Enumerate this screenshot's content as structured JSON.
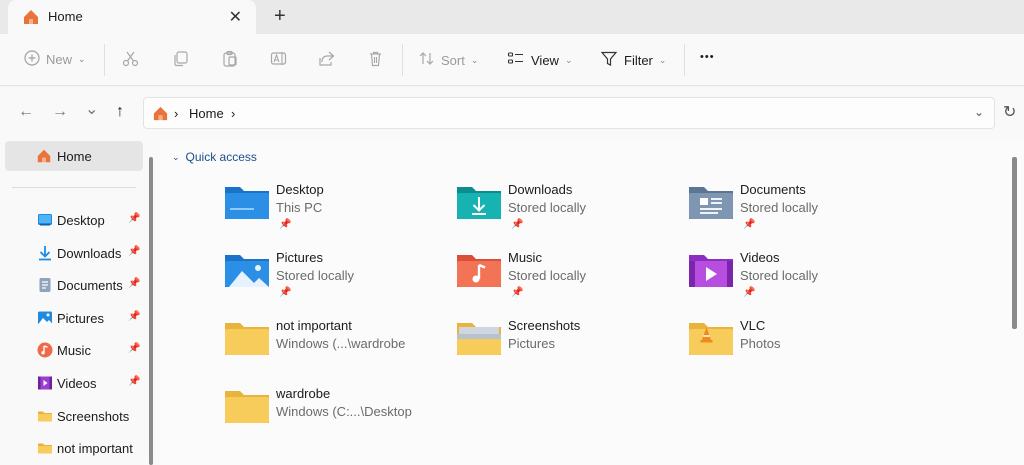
{
  "tab": {
    "title": "Home",
    "close_glyph": "✕",
    "add_glyph": "+"
  },
  "toolbar": {
    "new_label": "New",
    "sort_label": "Sort",
    "view_label": "View",
    "filter_label": "Filter",
    "more_glyph": "•••"
  },
  "address": {
    "back_glyph": "←",
    "forward_glyph": "→",
    "recent_glyph": "⌄",
    "up_glyph": "↑",
    "crumb_sep": "›",
    "crumb_home": "Home",
    "dropdown_glyph": "⌄",
    "refresh_glyph": "↻"
  },
  "sidebar": {
    "home_label": "Home",
    "items": [
      {
        "label": "Desktop",
        "icon": "desktop-icon",
        "pinned": true
      },
      {
        "label": "Downloads",
        "icon": "downloads-icon",
        "pinned": true
      },
      {
        "label": "Documents",
        "icon": "documents-icon",
        "pinned": true
      },
      {
        "label": "Pictures",
        "icon": "pictures-icon",
        "pinned": true
      },
      {
        "label": "Music",
        "icon": "music-icon",
        "pinned": true
      },
      {
        "label": "Videos",
        "icon": "videos-icon",
        "pinned": true
      },
      {
        "label": "Screenshots",
        "icon": "folder-icon",
        "pinned": false
      },
      {
        "label": "not important",
        "icon": "folder-icon",
        "pinned": false
      }
    ],
    "pin_glyph": "📌"
  },
  "main": {
    "section_label": "Quick access",
    "section_chevron": "⌄",
    "tiles": [
      {
        "name": "Desktop",
        "sub": "This PC",
        "pinned": true,
        "icon": "desktop-folder-icon"
      },
      {
        "name": "Downloads",
        "sub": "Stored locally",
        "pinned": true,
        "icon": "downloads-folder-icon"
      },
      {
        "name": "Documents",
        "sub": "Stored locally",
        "pinned": true,
        "icon": "documents-folder-icon"
      },
      {
        "name": "Pictures",
        "sub": "Stored locally",
        "pinned": true,
        "icon": "pictures-folder-icon"
      },
      {
        "name": "Music",
        "sub": "Stored locally",
        "pinned": true,
        "icon": "music-folder-icon"
      },
      {
        "name": "Videos",
        "sub": "Stored locally",
        "pinned": true,
        "icon": "videos-folder-icon"
      },
      {
        "name": "not important",
        "sub": "Windows (...\\wardrobe",
        "pinned": false,
        "icon": "folder-icon"
      },
      {
        "name": "Screenshots",
        "sub": "Pictures",
        "pinned": false,
        "icon": "screenshots-folder-icon"
      },
      {
        "name": "VLC",
        "sub": "Photos",
        "pinned": false,
        "icon": "vlc-folder-icon"
      },
      {
        "name": "wardrobe",
        "sub": "Windows (C:...\\Desktop",
        "pinned": false,
        "icon": "folder-icon"
      }
    ]
  },
  "colors": {
    "folder_yellow": "#f8cc5a",
    "accent_blue": "#1d4f8a",
    "home_orange": "#e8743b"
  }
}
